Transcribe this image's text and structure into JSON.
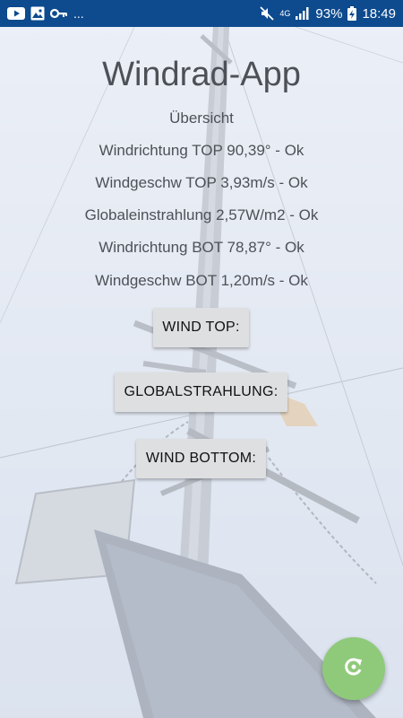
{
  "status_bar": {
    "left_icons": [
      "youtube-icon",
      "image-icon",
      "key-icon"
    ],
    "more": "...",
    "network": "4G",
    "battery_percent": "93%",
    "time": "18:49",
    "bar_color": "#0d4a8e"
  },
  "app": {
    "title": "Windrad-App",
    "subtitle": "Übersicht",
    "readings": [
      "Windrichtung TOP 90,39° - Ok",
      "Windgeschw TOP 3,93m/s - Ok",
      "Globaleinstrahlung 2,57W/m2 - Ok",
      "Windrichtung BOT 78,87° - Ok",
      "Windgeschw BOT 1,20m/s - Ok"
    ]
  },
  "buttons": {
    "wind_top": "WIND TOP:",
    "globalstrahlung": "GLOBALSTRAHLUNG:",
    "wind_bottom": "WIND BOTTOM:"
  },
  "fab": {
    "icon": "refresh-icon",
    "color": "#8fca7b"
  }
}
